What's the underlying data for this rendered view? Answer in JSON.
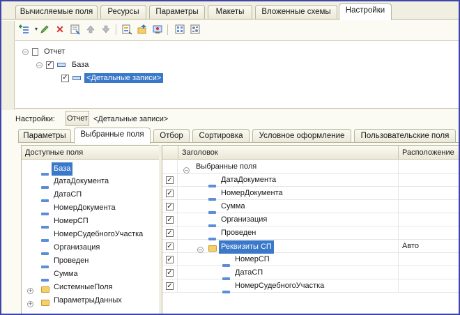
{
  "top_tabs": [
    {
      "label": "Вычисляемые поля",
      "active": false
    },
    {
      "label": "Ресурсы",
      "active": false
    },
    {
      "label": "Параметры",
      "active": false
    },
    {
      "label": "Макеты",
      "active": false
    },
    {
      "label": "Вложенные схемы",
      "active": false
    },
    {
      "label": "Настройки",
      "active": true
    }
  ],
  "toolbar": {
    "icons": [
      "add-dropdown-icon",
      "edit-icon",
      "delete-icon",
      "properties-icon",
      "move-up-icon",
      "move-down-icon",
      "group-icon",
      "add-parent-icon",
      "user-settings-icon",
      "structure-settings-icon",
      "view-settings-icon"
    ]
  },
  "structure_tree": {
    "root": "Отчет",
    "child": "База",
    "leaf": "<Детальные записи>"
  },
  "settings": {
    "label": "Настройки:",
    "button": "Отчет",
    "current": "<Детальные записи>"
  },
  "sub_tabs": [
    {
      "label": "Параметры",
      "active": false
    },
    {
      "label": "Выбранные поля",
      "active": true
    },
    {
      "label": "Отбор",
      "active": false
    },
    {
      "label": "Сортировка",
      "active": false
    },
    {
      "label": "Условное оформление",
      "active": false
    },
    {
      "label": "Пользовательские поля",
      "active": false
    }
  ],
  "available_fields": {
    "header": "Доступные поля",
    "items": [
      {
        "label": "База",
        "type": "field",
        "selected": true
      },
      {
        "label": "ДатаДокумента",
        "type": "field"
      },
      {
        "label": "ДатаСП",
        "type": "field"
      },
      {
        "label": "НомерДокумента",
        "type": "field"
      },
      {
        "label": "НомерСП",
        "type": "field"
      },
      {
        "label": "НомерСудебногоУчастка",
        "type": "field"
      },
      {
        "label": "Организация",
        "type": "field"
      },
      {
        "label": "Проведен",
        "type": "field"
      },
      {
        "label": "Сумма",
        "type": "field"
      },
      {
        "label": "СистемныеПоля",
        "type": "folder"
      },
      {
        "label": "ПараметрыДанных",
        "type": "folder"
      }
    ]
  },
  "selected_fields": {
    "col_header": "Заголовок",
    "col_location": "Расположение",
    "root": "Выбранные поля",
    "rows": [
      {
        "label": "ДатаДокумента",
        "checked": true,
        "level": 1,
        "type": "field",
        "location": ""
      },
      {
        "label": "НомерДокумента",
        "checked": true,
        "level": 1,
        "type": "field",
        "location": ""
      },
      {
        "label": "Сумма",
        "checked": true,
        "level": 1,
        "type": "field",
        "location": ""
      },
      {
        "label": "Организация",
        "checked": true,
        "level": 1,
        "type": "field",
        "location": ""
      },
      {
        "label": "Проведен",
        "checked": true,
        "level": 1,
        "type": "field",
        "location": ""
      },
      {
        "label": "Реквизиты СП",
        "checked": true,
        "level": 1,
        "type": "folder",
        "location": "Авто",
        "selected": true
      },
      {
        "label": "НомерСП",
        "checked": true,
        "level": 2,
        "type": "field",
        "location": ""
      },
      {
        "label": "ДатаСП",
        "checked": true,
        "level": 2,
        "type": "field",
        "location": ""
      },
      {
        "label": "НомерСудебногоУчастка",
        "checked": true,
        "level": 2,
        "type": "field",
        "location": ""
      }
    ]
  },
  "colors": {
    "frame": "#3c45a8",
    "selection": "#3a78c9",
    "field_icon": "#5b8ed6",
    "folder": "#f4cf6a"
  }
}
